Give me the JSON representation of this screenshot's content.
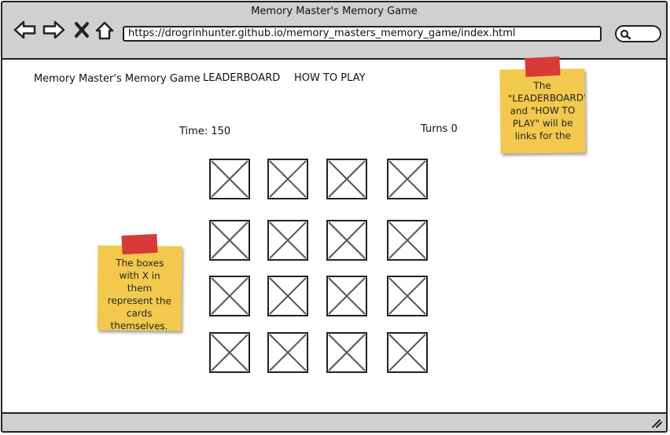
{
  "window": {
    "title": "Memory Master's Memory Game",
    "url": "https://drogrinhunter.github.io/memory_masters_memory_game/index.html",
    "back_icon": "back-arrow-icon",
    "forward_icon": "forward-arrow-icon",
    "stop_icon": "close-icon",
    "home_icon": "home-icon",
    "search_icon": "search-icon"
  },
  "nav": {
    "brand": "Memory Master's Memory Game",
    "leaderboard": "LEADERBOARD",
    "how_to_play": "HOW TO PLAY"
  },
  "stats": {
    "time": "Time: 150",
    "turns": "Turns 0"
  },
  "cards": {
    "rows": 4,
    "cols": 4,
    "placeholder_icon": "image-placeholder-icon"
  },
  "notes": {
    "cards_note": "The boxes with X in them represent the cards themselves.",
    "links_note": "The \"LEADERBOARD\" and \"HOW TO PLAY\" will be links for the"
  },
  "colors": {
    "chrome": "#d0d0d0",
    "sticky_note": "#f2c94c",
    "tape": "#d83a35"
  }
}
